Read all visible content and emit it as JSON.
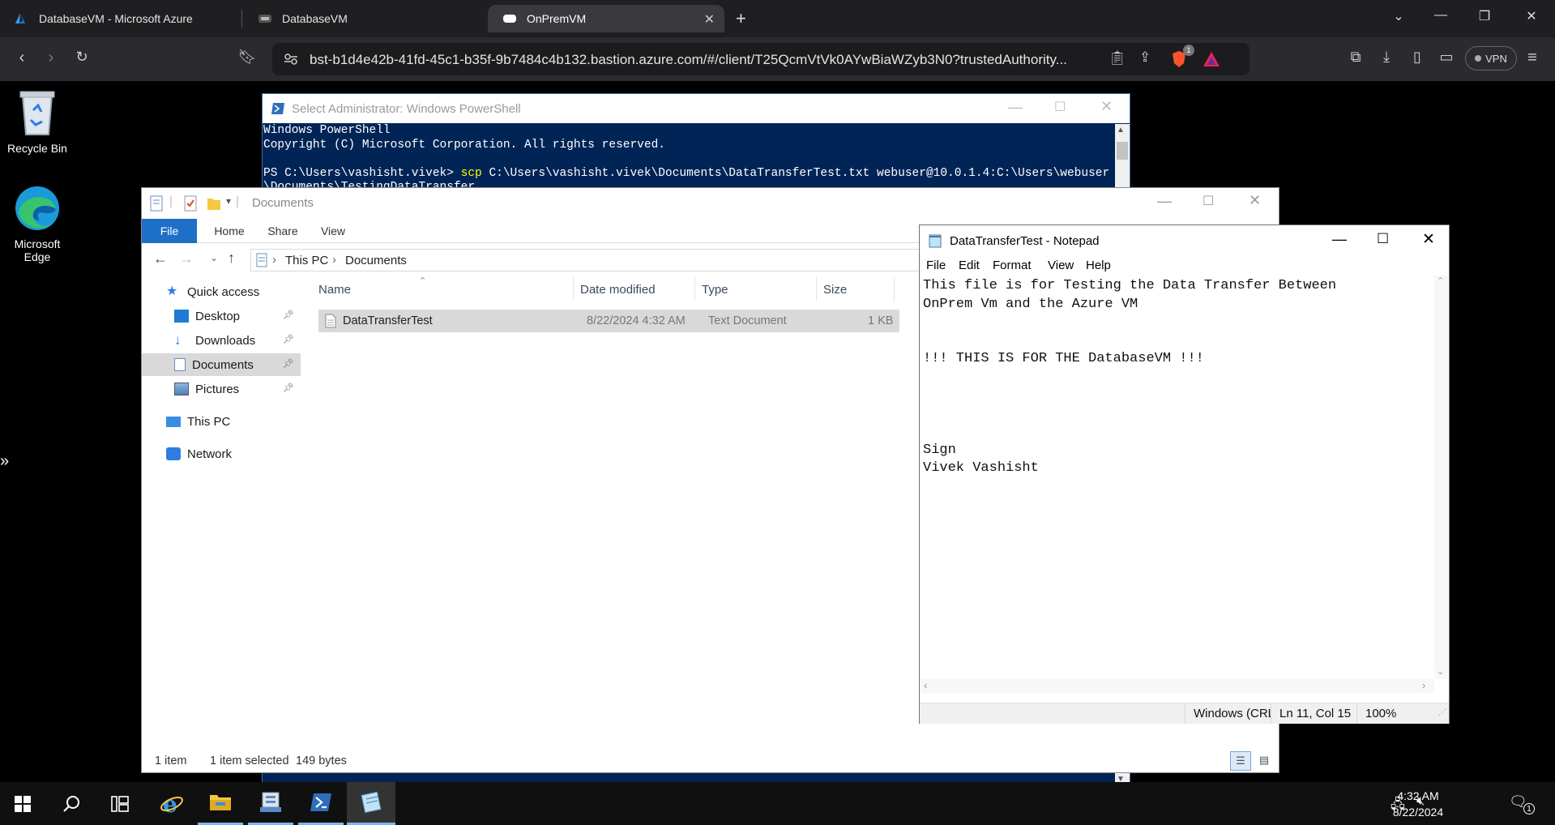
{
  "browser": {
    "tabs": [
      {
        "label": "DatabaseVM - Microsoft Azure"
      },
      {
        "label": "DatabaseVM"
      },
      {
        "label": "OnPremVM"
      }
    ],
    "url": "bst-b1d4e42b-41fd-45c1-b35f-9b7484c4b132.bastion.azure.com/#/client/T25QcmVtVk0AYwBiaWZyb3N0?trustedAuthority...",
    "vpn_label": "VPN",
    "brave_badge": "1"
  },
  "desktop": {
    "icons": [
      {
        "label": "Recycle Bin"
      },
      {
        "label": "Microsoft Edge"
      }
    ]
  },
  "powershell": {
    "title": "Select Administrator: Windows PowerShell",
    "line1": "Windows PowerShell",
    "line2": "Copyright (C) Microsoft Corporation. All rights reserved.",
    "prompt": "PS C:\\Users\\vashisht.vivek> ",
    "command": "scp",
    "args": " C:\\Users\\vashisht.vivek\\Documents\\DataTransferTest.txt webuser@10.0.1.4:C:\\Users\\webuser",
    "args_wrap": "\\Documents\\TestingDataTransfer"
  },
  "explorer": {
    "title": "Documents",
    "ribbon": {
      "file": "File",
      "home": "Home",
      "share": "Share",
      "view": "View"
    },
    "breadcrumb": {
      "root": "This PC",
      "current": "Documents"
    },
    "nav": {
      "quick_access": "Quick access",
      "desktop": "Desktop",
      "downloads": "Downloads",
      "documents": "Documents",
      "pictures": "Pictures",
      "this_pc": "This PC",
      "network": "Network"
    },
    "columns": {
      "name": "Name",
      "date": "Date modified",
      "type": "Type",
      "size": "Size"
    },
    "files": [
      {
        "name": "DataTransferTest",
        "date": "8/22/2024 4:32 AM",
        "type": "Text Document",
        "size": "1 KB"
      }
    ],
    "status": {
      "count": "1 item",
      "selected": "1 item selected",
      "bytes": "149 bytes"
    }
  },
  "notepad": {
    "title": "DataTransferTest - Notepad",
    "menu": {
      "file": "File",
      "edit": "Edit",
      "format": "Format",
      "view": "View",
      "help": "Help"
    },
    "content": "This file is for Testing the Data Transfer Between\nOnPrem Vm and the Azure VM\n\n\n!!! THIS IS FOR THE DatabaseVM !!!\n\n\n\n\nSign\nVivek Vashisht",
    "status": {
      "encoding": "Windows (CRL",
      "position": "Ln 11, Col 15",
      "zoom": "100%"
    }
  },
  "taskbar": {
    "time": "4:32 AM",
    "date": "8/22/2024",
    "notification_count": "1"
  },
  "colors": {
    "powershell_bg": "#012456",
    "explorer_file_tab": "#1e6fc7",
    "selection_gray": "#d9d9d9",
    "browser_tabbar": "#1f1f22"
  }
}
